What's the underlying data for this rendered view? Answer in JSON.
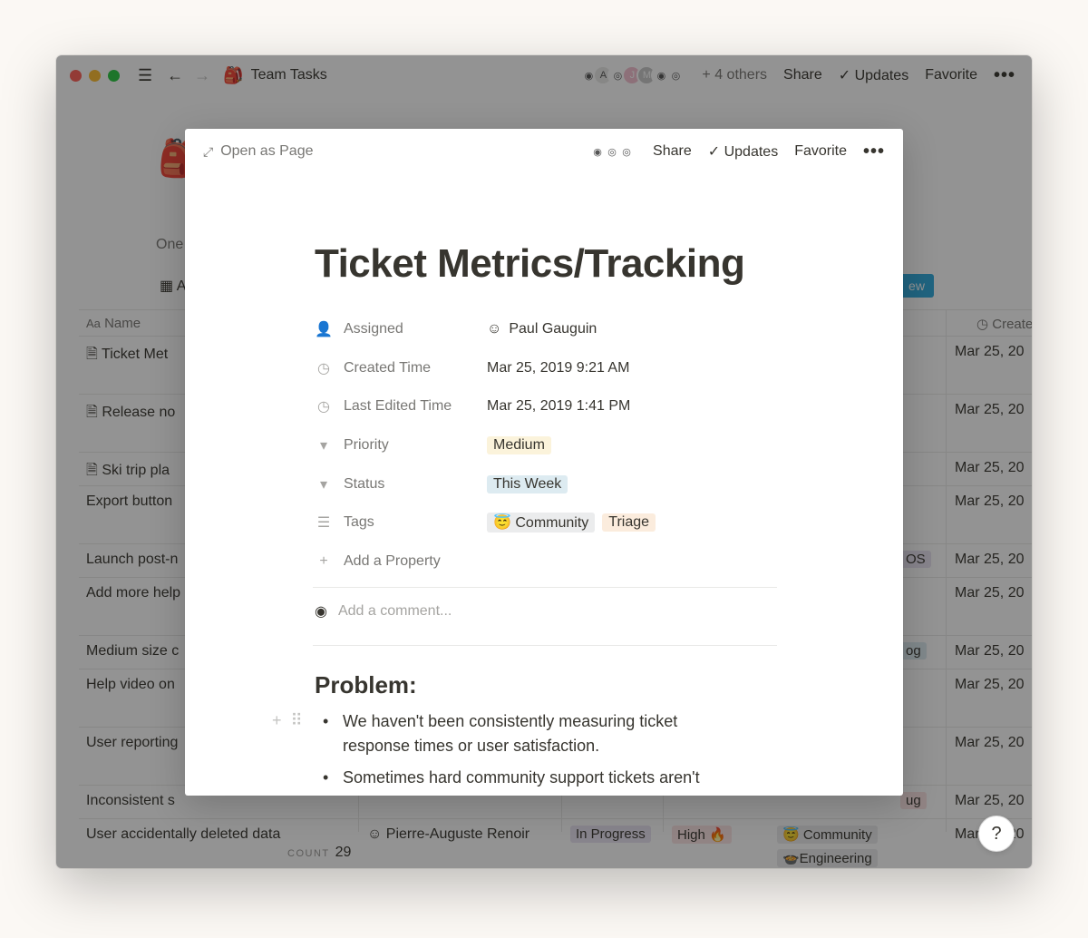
{
  "window": {
    "title": "Team Tasks",
    "title_icon": "backpack-icon",
    "others_label": "+ 4 others",
    "share_label": "Share",
    "updates_label": "Updates",
    "favorite_label": "Favorite",
    "more_label": "•••",
    "avatar_letters": [
      "A",
      "J",
      "M"
    ]
  },
  "background": {
    "description_fragment": "One",
    "table_tab_fragment": "A",
    "new_button_fragment": "ew",
    "columns": {
      "name": "Name",
      "created": "Created"
    },
    "rows": [
      {
        "name": "Ticket Met",
        "date": "Mar 25, 20"
      },
      {
        "name": "Release no",
        "date": "Mar 25, 20"
      },
      {
        "name": "Ski trip pla",
        "date": "Mar 25, 20"
      },
      {
        "name": "Export button",
        "date": "Mar 25, 20"
      },
      {
        "name": "Launch post-n",
        "date": "Mar 25, 20",
        "tag": "OS"
      },
      {
        "name": "Add more help",
        "date": "Mar 25, 20"
      },
      {
        "name": "Medium size c",
        "date": "Mar 25, 20",
        "tag": "og"
      },
      {
        "name": "Help video on",
        "date": "Mar 25, 20"
      },
      {
        "name": "User reporting",
        "date": "Mar 25, 20"
      },
      {
        "name": "Inconsistent s",
        "date": "Mar 25, 20",
        "tag": "ug"
      },
      {
        "name": "User accidentally deleted data",
        "date": "Mar 25, 20",
        "person": "Pierre-Auguste Renoir",
        "status": "In Progress",
        "priority": "High 🔥",
        "tag1": "😇 Community",
        "tag2": "🍲Engineering"
      }
    ],
    "count_label": "COUNT",
    "count_value": "29",
    "help_label": "?"
  },
  "modal": {
    "open_as_page": "Open as Page",
    "share_label": "Share",
    "updates_label": "Updates",
    "favorite_label": "Favorite",
    "more_label": "•••",
    "title": "Ticket Metrics/Tracking",
    "properties": {
      "assigned": {
        "label": "Assigned",
        "value": "Paul Gauguin"
      },
      "created": {
        "label": "Created Time",
        "value": "Mar 25, 2019 9:21 AM"
      },
      "edited": {
        "label": "Last Edited Time",
        "value": "Mar 25, 2019 1:41 PM"
      },
      "priority": {
        "label": "Priority",
        "value": "Medium"
      },
      "status": {
        "label": "Status",
        "value": "This Week"
      },
      "tags": {
        "label": "Tags",
        "values": [
          "😇 Community",
          "Triage"
        ]
      }
    },
    "add_property": "Add a Property",
    "comment_placeholder": "Add a comment...",
    "heading": "Problem:",
    "bullets": [
      "We haven't been consistently measuring ticket response times or user satisfaction.",
      "Sometimes hard community support tickets aren't"
    ]
  },
  "colors": {
    "medium_tag": "#fbf3db",
    "this_week_tag": "#ddebf1",
    "community_tag": "#ebeced",
    "triage_tag": "#fbecdd",
    "accent": "#2eaadc"
  }
}
